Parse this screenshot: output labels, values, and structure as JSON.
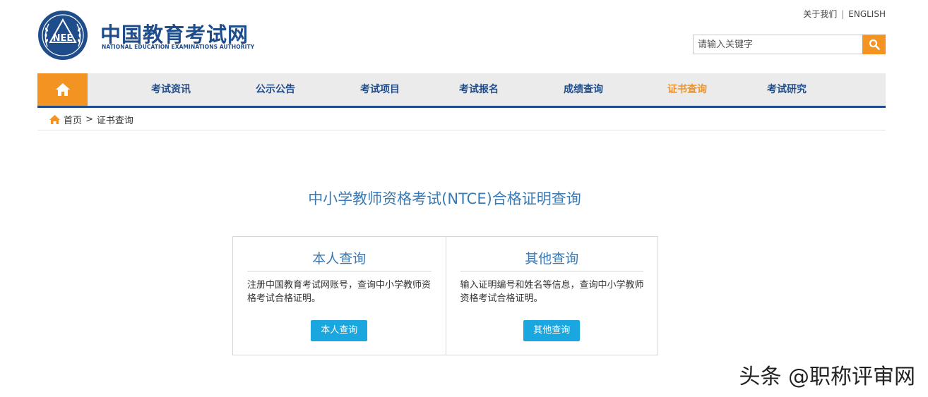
{
  "header": {
    "site_title": "中国教育考试网",
    "site_subtitle": "NATIONAL EDUCATION EXAMINATIONS AUTHORITY",
    "logo_text": "NEE",
    "top_links": [
      "关于我们",
      "ENGLISH"
    ],
    "top_sep": "|",
    "search": {
      "placeholder": "请输入关键字",
      "value": ""
    }
  },
  "nav": {
    "items": [
      "考试资讯",
      "公示公告",
      "考试项目",
      "考试报名",
      "成绩查询",
      "证书查询",
      "考试研究"
    ],
    "active": "证书查询"
  },
  "breadcrumb": {
    "home": "首页",
    "sep": ">",
    "current": "证书查询"
  },
  "main": {
    "title": "中小学教师资格考试(NTCE)合格证明查询",
    "panels": [
      {
        "heading": "本人查询",
        "desc": "注册中国教育考试网账号，查询中小学教师资格考试合格证明。",
        "button": "本人查询"
      },
      {
        "heading": "其他查询",
        "desc": "输入证明编号和姓名等信息，查询中小学教师资格考试合格证明。",
        "button": "其他查询"
      }
    ]
  },
  "watermark": "头条 @职称评审网",
  "colors": {
    "brand_blue": "#1f4d8c",
    "accent_orange": "#f39322",
    "title_blue": "#3a7bb5",
    "button_blue": "#1aa7e0"
  }
}
